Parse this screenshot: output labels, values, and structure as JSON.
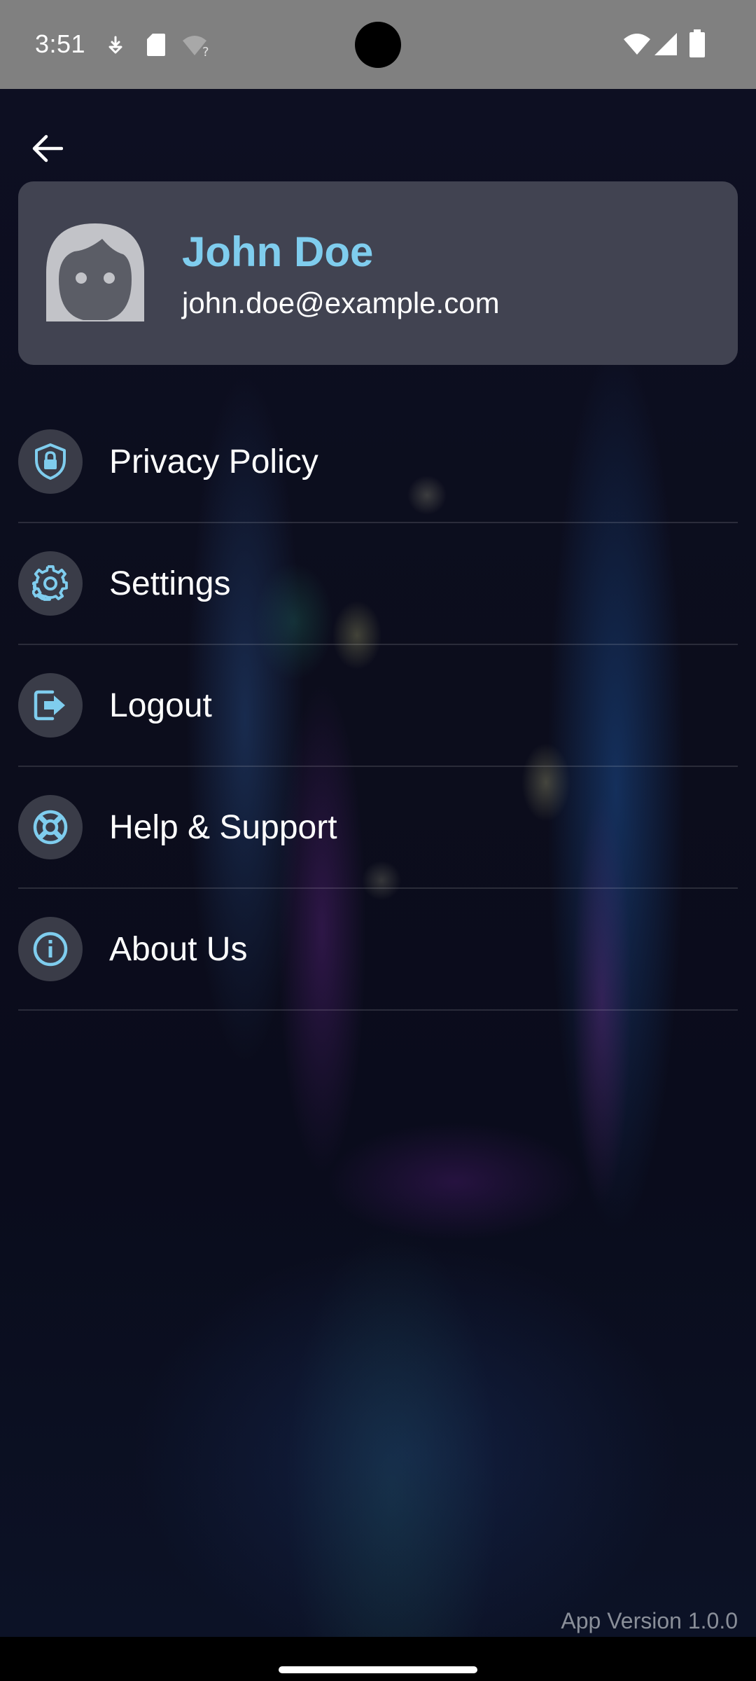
{
  "status_bar": {
    "time": "3:51",
    "icons": [
      "download-status-icon",
      "sd-card-icon",
      "wifi-unknown-icon",
      "wifi-icon",
      "cellular-signal-icon",
      "battery-icon"
    ]
  },
  "header": {
    "back_icon": "arrow-back-icon"
  },
  "profile": {
    "name": "John Doe",
    "email": "john.doe@example.com",
    "avatar_icon": "face-avatar-icon"
  },
  "menu": {
    "items": [
      {
        "label": "Privacy Policy",
        "icon": "shield-lock-icon"
      },
      {
        "label": "Settings",
        "icon": "gear-icon"
      },
      {
        "label": "Logout",
        "icon": "logout-icon"
      },
      {
        "label": "Help & Support",
        "icon": "lifebuoy-icon"
      },
      {
        "label": "About Us",
        "icon": "info-icon"
      }
    ]
  },
  "footer": {
    "app_version": "App Version 1.0.0"
  },
  "colors": {
    "accent": "#7fcdee",
    "status_bar_bg": "#808080",
    "card_bg": "#5d5f69",
    "icon_circle_bg": "#3a3c48"
  }
}
